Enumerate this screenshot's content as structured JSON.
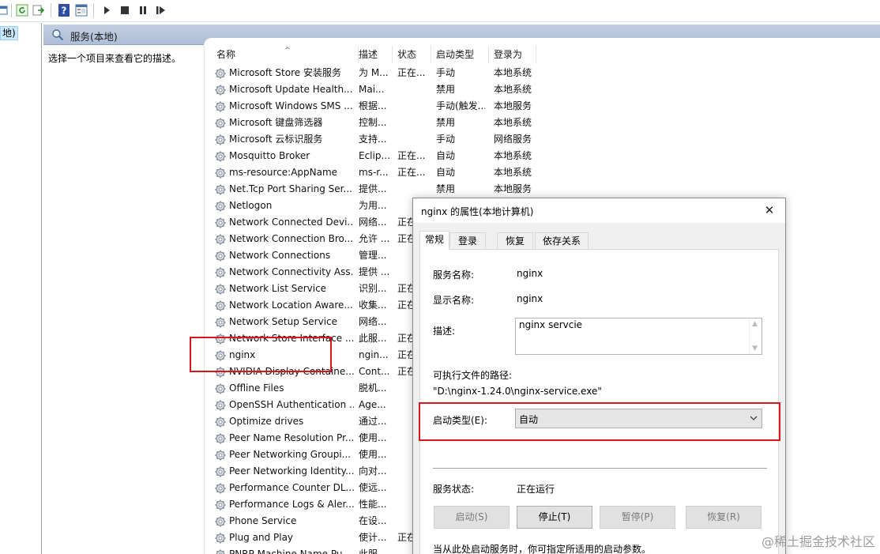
{
  "toolbar": {
    "icons": [
      "refresh-icon",
      "export-icon",
      "help-icon",
      "properties-icon",
      "play-icon",
      "stop-icon",
      "pause-icon",
      "restart-icon"
    ]
  },
  "tree": {
    "selected_label": "地)"
  },
  "pane": {
    "title": "服务(本地)",
    "description_placeholder": "选择一个项目来查看它的描述。"
  },
  "columns": {
    "name": "名称",
    "description": "描述",
    "status": "状态",
    "startup_type": "启动类型",
    "logon_as": "登录为"
  },
  "services": [
    {
      "name": "Microsoft Store 安装服务",
      "desc": "为 M...",
      "status": "正在...",
      "type": "手动",
      "logon": "本地系统"
    },
    {
      "name": "Microsoft Update Health...",
      "desc": "Mai...",
      "status": "",
      "type": "禁用",
      "logon": "本地系统"
    },
    {
      "name": "Microsoft Windows SMS ...",
      "desc": "根据...",
      "status": "",
      "type": "手动(触发...",
      "logon": "本地服务"
    },
    {
      "name": "Microsoft 键盘筛选器",
      "desc": "控制...",
      "status": "",
      "type": "禁用",
      "logon": "本地系统"
    },
    {
      "name": "Microsoft 云标识服务",
      "desc": "支持...",
      "status": "",
      "type": "手动",
      "logon": "网络服务"
    },
    {
      "name": "Mosquitto Broker",
      "desc": "Eclip...",
      "status": "正在...",
      "type": "自动",
      "logon": "本地系统"
    },
    {
      "name": "ms-resource:AppName",
      "desc": "ms-r...",
      "status": "正在...",
      "type": "自动",
      "logon": "本地系统"
    },
    {
      "name": "Net.Tcp Port Sharing Ser...",
      "desc": "提供...",
      "status": "",
      "type": "禁用",
      "logon": "本地服务"
    },
    {
      "name": "Netlogon",
      "desc": "为用...",
      "status": "",
      "type": "",
      "logon": ""
    },
    {
      "name": "Network Connected Devi...",
      "desc": "网络...",
      "status": "正在",
      "type": "",
      "logon": ""
    },
    {
      "name": "Network Connection Bro...",
      "desc": "允许 ...",
      "status": "正在",
      "type": "",
      "logon": ""
    },
    {
      "name": "Network Connections",
      "desc": "管理...",
      "status": "",
      "type": "",
      "logon": ""
    },
    {
      "name": "Network Connectivity Ass...",
      "desc": "提供 ...",
      "status": "",
      "type": "",
      "logon": ""
    },
    {
      "name": "Network List Service",
      "desc": "识别...",
      "status": "正在",
      "type": "",
      "logon": ""
    },
    {
      "name": "Network Location Aware...",
      "desc": "收集...",
      "status": "正在",
      "type": "",
      "logon": ""
    },
    {
      "name": "Network Setup Service",
      "desc": "网络...",
      "status": "",
      "type": "",
      "logon": ""
    },
    {
      "name": "Network Store Interface ...",
      "desc": "此服...",
      "status": "正在",
      "type": "",
      "logon": ""
    },
    {
      "name": "nginx",
      "desc": "ngin...",
      "status": "正在",
      "type": "",
      "logon": ""
    },
    {
      "name": "NVIDIA Display Containe...",
      "desc": "Cont...",
      "status": "正在",
      "type": "",
      "logon": ""
    },
    {
      "name": "Offline Files",
      "desc": "脱机...",
      "status": "",
      "type": "",
      "logon": ""
    },
    {
      "name": "OpenSSH Authentication ...",
      "desc": "Age...",
      "status": "",
      "type": "",
      "logon": ""
    },
    {
      "name": "Optimize drives",
      "desc": "通过...",
      "status": "",
      "type": "",
      "logon": ""
    },
    {
      "name": "Peer Name Resolution Pr...",
      "desc": "使用...",
      "status": "",
      "type": "",
      "logon": ""
    },
    {
      "name": "Peer Networking Groupi...",
      "desc": "使用...",
      "status": "",
      "type": "",
      "logon": ""
    },
    {
      "name": "Peer Networking Identity...",
      "desc": "向对...",
      "status": "",
      "type": "",
      "logon": ""
    },
    {
      "name": "Performance Counter DL...",
      "desc": "使远...",
      "status": "",
      "type": "",
      "logon": ""
    },
    {
      "name": "Performance Logs & Aler...",
      "desc": "性能...",
      "status": "",
      "type": "",
      "logon": ""
    },
    {
      "name": "Phone Service",
      "desc": "在设...",
      "status": "",
      "type": "",
      "logon": ""
    },
    {
      "name": "Plug and Play",
      "desc": "使计...",
      "status": "正在",
      "type": "",
      "logon": ""
    },
    {
      "name": "PNRP Machine Name Pu...",
      "desc": "此服...",
      "status": "",
      "type": "",
      "logon": ""
    }
  ],
  "dialog": {
    "title": "nginx 的属性(本地计算机)",
    "close_glyph": "✕",
    "tabs": [
      "常规",
      "登录",
      "恢复",
      "依存关系"
    ],
    "service_name_label": "服务名称:",
    "service_name": "nginx",
    "display_name_label": "显示名称:",
    "display_name": "nginx",
    "description_label": "描述:",
    "description": "nginx servcie",
    "exe_path_label": "可执行文件的路径:",
    "exe_path": "\"D:\\nginx-1.24.0\\nginx-service.exe\"",
    "startup_type_label": "启动类型(E):",
    "startup_type": "自动",
    "status_label": "服务状态:",
    "status": "正在运行",
    "buttons": [
      {
        "label": "启动(S)",
        "enabled": false
      },
      {
        "label": "停止(T)",
        "enabled": true
      },
      {
        "label": "暂停(P)",
        "enabled": false
      },
      {
        "label": "恢复(R)",
        "enabled": false
      }
    ],
    "footer_hint": "当从此处启动服务时，你可指定所适用的启动参数。"
  },
  "watermark": "@稀土掘金技术社区",
  "colors": {
    "highlight_red": "#d9151f",
    "header_blue": "#b8c7de",
    "selection_blue": "#cce8ff"
  }
}
